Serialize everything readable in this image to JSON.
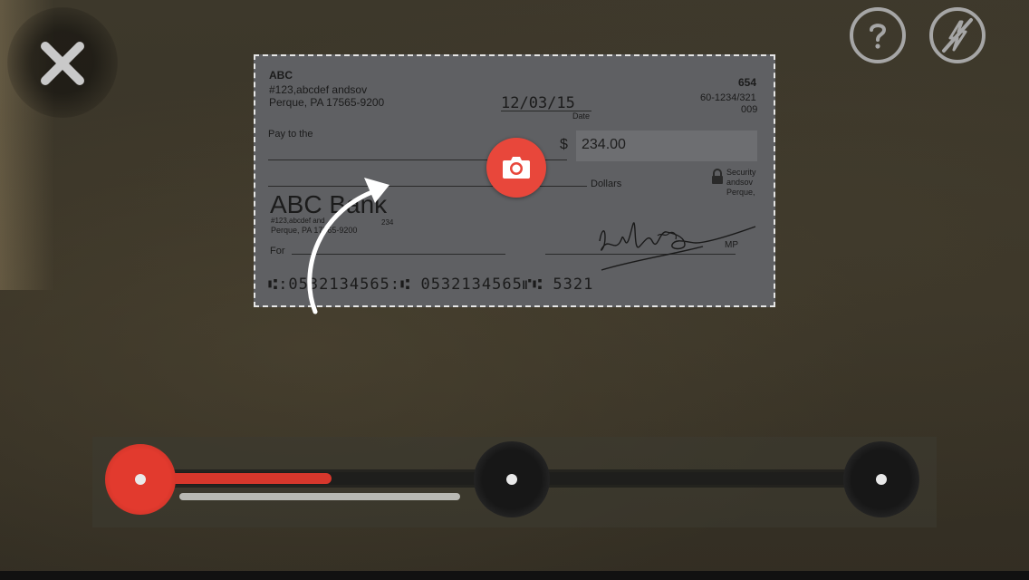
{
  "check": {
    "payer_name": "ABC",
    "payer_address1": "#123,abcdef andsov",
    "payer_address2": "Perque, PA 17565-9200",
    "check_number": "654",
    "routing_fraction1": "60-1234/321",
    "routing_fraction2": "009",
    "date_value": "12/03/15",
    "date_label": "Date",
    "pay_to_label": "Pay to the",
    "currency_symbol": "$",
    "amount": "234.00",
    "dollars_label": "Dollars",
    "security_line1": "Security",
    "security_line2": "andsov",
    "security_line3": "Perque,",
    "bank_name": "ABC Bank",
    "bank_address1": "#123,abcdef and",
    "bank_address2": "Perque, PA 17565-9200",
    "bank_code": "234",
    "for_label": "For",
    "signature_initials": "MP",
    "micr_line": "⑆:0532134565:⑆ 0532134565⑈⑆ 5321"
  },
  "icons": {
    "close": "close-icon",
    "help": "help-icon",
    "flash_off": "flash-off-icon",
    "camera": "camera-icon",
    "arrow": "curved-arrow-icon",
    "lock": "lock-icon"
  },
  "colors": {
    "accent": "#e8473b",
    "check_overlay": "#5f6063",
    "button_outline": "#a6a6a6"
  },
  "progress": {
    "steps_total": 3,
    "current_step": 1,
    "fill_fraction": 0.3
  }
}
